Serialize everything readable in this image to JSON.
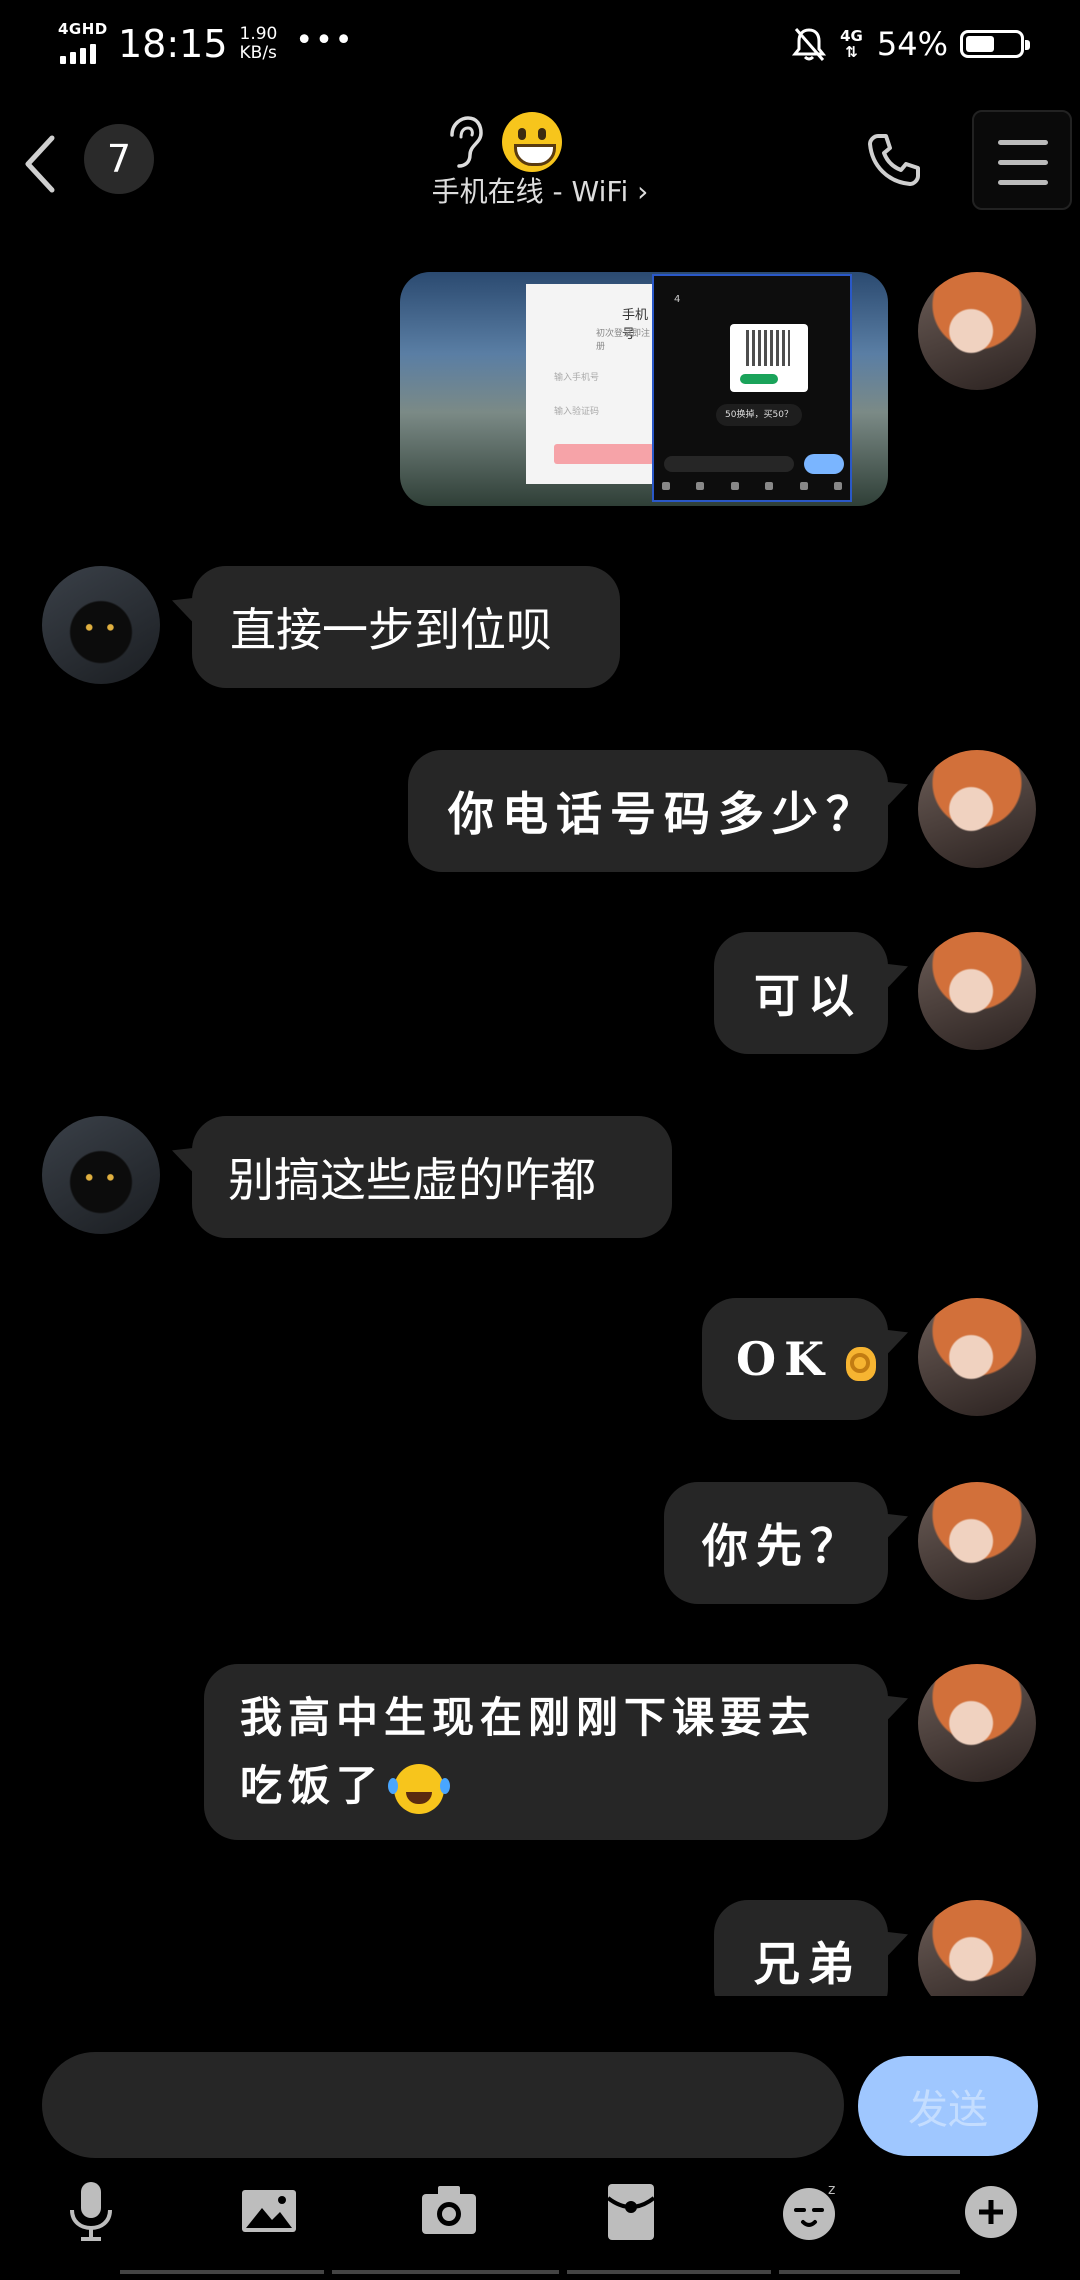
{
  "status_bar": {
    "network_label": "4GHD",
    "time": "18:15",
    "speed_value": "1.90",
    "speed_unit": "KB/s",
    "dots": "•••",
    "mobile_label": "4G",
    "battery_percent": "54%",
    "battery_level": 0.54
  },
  "header": {
    "unread_count": "7",
    "subtitle": "手机在线 - WiFi ›"
  },
  "screenshot_message": {
    "dialog_title": "手机号",
    "dialog_subtitle": "初次登录即注册",
    "phone_placeholder": "输入手机号",
    "code_placeholder": "输入验证码",
    "qq_badge": "4",
    "qq_bubble": "50换掉，买50？"
  },
  "messages": [
    {
      "side": "left",
      "text": "直接一步到位呗"
    },
    {
      "side": "right",
      "text": "你电话号码多少？"
    },
    {
      "side": "right",
      "text": "可以"
    },
    {
      "side": "left",
      "text": "别搞这些虚的咋都"
    },
    {
      "side": "right",
      "text": "OK"
    },
    {
      "side": "right",
      "text": "你先？"
    },
    {
      "side": "right",
      "text": "我高中生现在刚刚下课要去",
      "line2": "吃饭了"
    },
    {
      "side": "right",
      "text": "兄弟"
    }
  ],
  "composer": {
    "input_value": "",
    "send_label": "发送"
  },
  "colors": {
    "background": "#000000",
    "bubble": "#262626",
    "send_disabled": "#9fc7ff"
  },
  "toolbar_icons": [
    "microphone-icon",
    "image-icon",
    "camera-icon",
    "red-packet-icon",
    "emoji-icon",
    "plus-icon"
  ]
}
